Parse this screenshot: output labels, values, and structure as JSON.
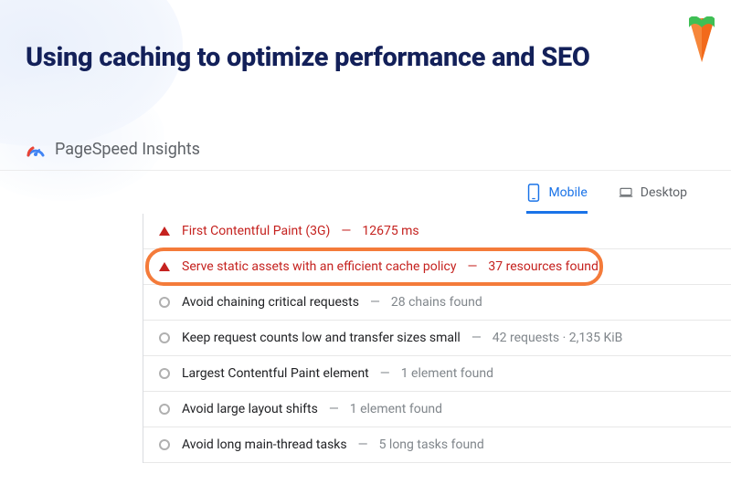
{
  "header": {
    "title": "Using caching to optimize performance and SEO"
  },
  "product": {
    "name": "PageSpeed Insights"
  },
  "tabs": {
    "mobile": "Mobile",
    "desktop": "Desktop",
    "active": "mobile"
  },
  "audits": [
    {
      "status": "fail",
      "label": "First Contentful Paint (3G)",
      "meta": "12675 ms",
      "highlight": false
    },
    {
      "status": "fail",
      "label": "Serve static assets with an efficient cache policy",
      "meta": "37 resources found",
      "highlight": true
    },
    {
      "status": "info",
      "label": "Avoid chaining critical requests",
      "meta": "28 chains found",
      "highlight": false
    },
    {
      "status": "info",
      "label": "Keep request counts low and transfer sizes small",
      "meta": "42 requests · 2,135 KiB",
      "highlight": false
    },
    {
      "status": "info",
      "label": "Largest Contentful Paint element",
      "meta": "1 element found",
      "highlight": false
    },
    {
      "status": "info",
      "label": "Avoid large layout shifts",
      "meta": "1 element found",
      "highlight": false
    },
    {
      "status": "info",
      "label": "Avoid long main-thread tasks",
      "meta": "5 long tasks found",
      "highlight": false
    }
  ]
}
